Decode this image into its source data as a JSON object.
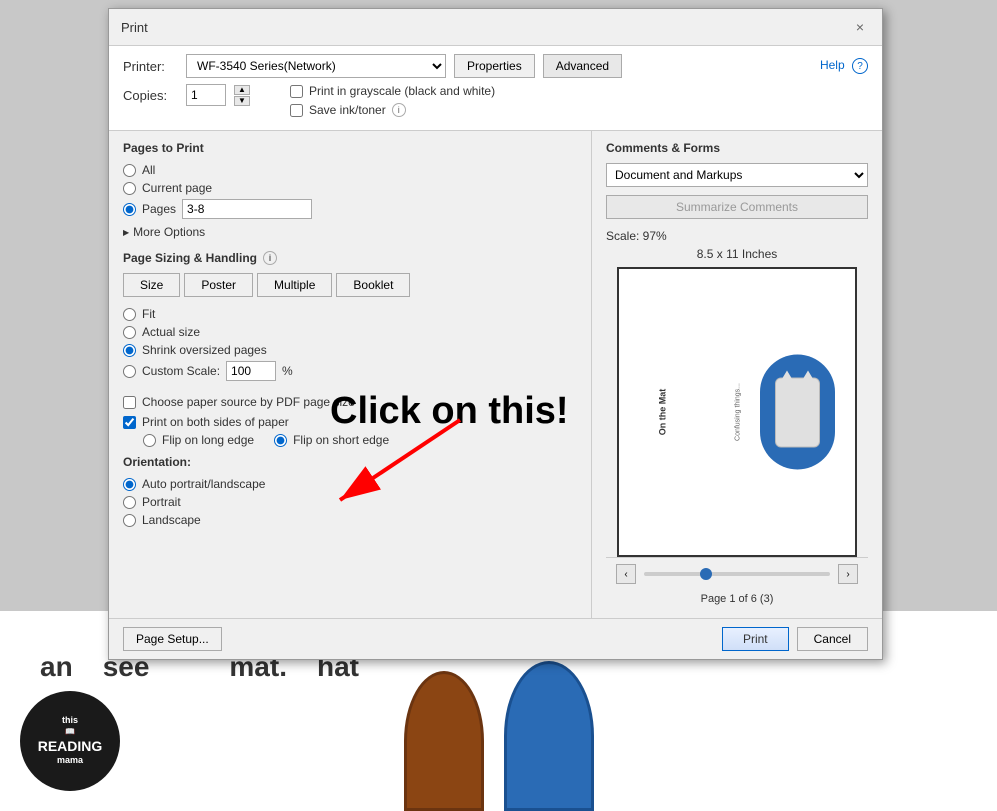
{
  "dialog": {
    "title": "Print",
    "close_label": "×"
  },
  "printer": {
    "label": "Printer:",
    "value": "WF-3540 Series(Network)",
    "properties_label": "Properties",
    "advanced_label": "Advanced"
  },
  "help": {
    "label": "Help",
    "icon": "?"
  },
  "copies": {
    "label": "Copies:",
    "value": "1"
  },
  "options": {
    "print_grayscale_label": "Print in grayscale (black and white)",
    "save_ink_label": "Save ink/toner"
  },
  "pages_to_print": {
    "title": "Pages to Print",
    "all_label": "All",
    "current_page_label": "Current page",
    "pages_label": "Pages",
    "pages_value": "3-8",
    "more_options_label": "More Options"
  },
  "page_sizing": {
    "title": "Page Sizing & Handling",
    "size_label": "Size",
    "poster_label": "Poster",
    "multiple_label": "Multiple",
    "booklet_label": "Booklet",
    "fit_label": "Fit",
    "actual_size_label": "Actual size",
    "shrink_label": "Shrink oversized pages",
    "custom_scale_label": "Custom Scale:",
    "custom_scale_value": "100",
    "percent_label": "%",
    "choose_paper_label": "Choose paper source by PDF page size"
  },
  "duplex": {
    "label": "Print on both sides of paper",
    "flip_long_label": "Flip on long edge",
    "flip_short_label": "Flip on short edge"
  },
  "orientation": {
    "title": "Orientation:",
    "auto_label": "Auto portrait/landscape",
    "portrait_label": "Portrait",
    "landscape_label": "Landscape"
  },
  "comments_forms": {
    "title": "Comments & Forms",
    "select_value": "Document and Markups",
    "summarize_label": "Summarize Comments"
  },
  "preview": {
    "scale_text": "Scale: 97%",
    "page_size_text": "8.5 x 11 Inches",
    "page_info": "Page 1 of 6 (3)"
  },
  "footer": {
    "page_setup_label": "Page Setup...",
    "print_label": "Print",
    "cancel_label": "Cancel"
  },
  "annotation": {
    "click_text": "Click on this!"
  },
  "background": {
    "words": [
      "an",
      "see",
      "mat.",
      "hat"
    ]
  }
}
